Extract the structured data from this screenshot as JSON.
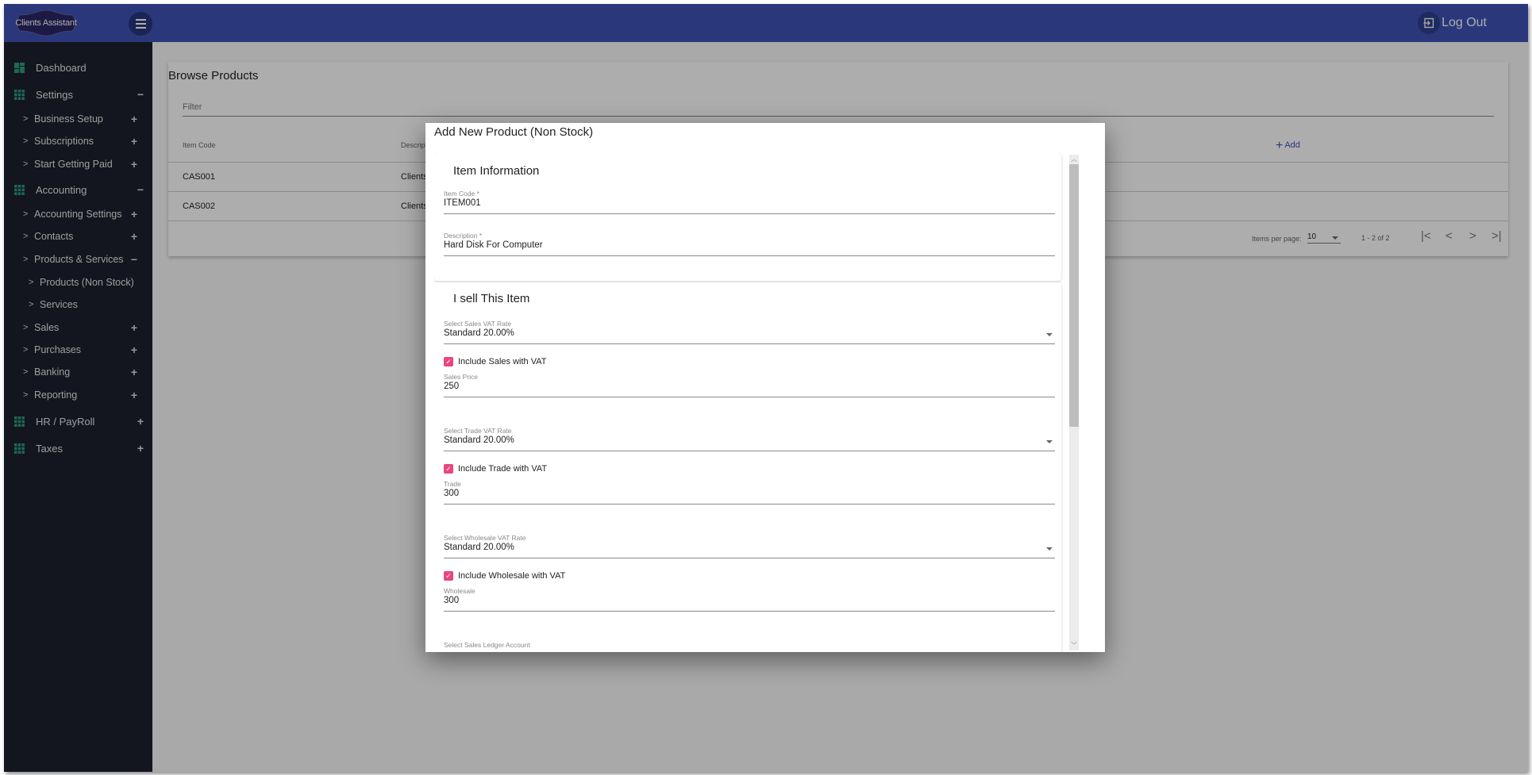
{
  "header": {
    "logo_text": "Clients Assistant",
    "logout_label": "Log Out"
  },
  "sidebar": {
    "items": [
      {
        "label": "Dashboard",
        "icon": "dashboard-icon",
        "level": 0,
        "toggle": ""
      },
      {
        "label": "Settings",
        "icon": "grid-icon",
        "level": 0,
        "toggle": "−"
      },
      {
        "label": "Business Setup",
        "level": 1,
        "toggle": "+"
      },
      {
        "label": "Subscriptions",
        "level": 1,
        "toggle": "+"
      },
      {
        "label": "Start Getting Paid",
        "level": 1,
        "toggle": "+"
      },
      {
        "label": "Accounting",
        "icon": "grid-icon",
        "level": 0,
        "toggle": "−"
      },
      {
        "label": "Accounting Settings",
        "level": 1,
        "toggle": "+"
      },
      {
        "label": "Contacts",
        "level": 1,
        "toggle": "+"
      },
      {
        "label": "Products & Services",
        "level": 1,
        "toggle": "−"
      },
      {
        "label": "Products (Non Stock)",
        "level": 2,
        "toggle": ""
      },
      {
        "label": "Services",
        "level": 2,
        "toggle": ""
      },
      {
        "label": "Sales",
        "level": 1,
        "toggle": "+"
      },
      {
        "label": "Purchases",
        "level": 1,
        "toggle": "+"
      },
      {
        "label": "Banking",
        "level": 1,
        "toggle": "+"
      },
      {
        "label": "Reporting",
        "level": 1,
        "toggle": "+"
      },
      {
        "label": "HR / PayRoll",
        "icon": "grid-icon",
        "level": 0,
        "toggle": "+"
      },
      {
        "label": "Taxes",
        "icon": "grid-icon",
        "level": 0,
        "toggle": "+"
      }
    ]
  },
  "browse": {
    "title": "Browse Products",
    "filter_placeholder": "Filter",
    "columns": [
      "Item Code",
      "Description"
    ],
    "add_label": "Add",
    "rows": [
      {
        "code": "CAS001",
        "description": "Clients"
      },
      {
        "code": "CAS002",
        "description": "Clients"
      }
    ],
    "paginator": {
      "items_per_page_label": "Items per page:",
      "items_per_page": "10",
      "range": "1 - 2 of 2"
    }
  },
  "dialog": {
    "title": "Add New Product (Non Stock)",
    "item_info": {
      "title": "Item Information",
      "item_code_label": "Item Code *",
      "item_code": "ITEM001",
      "description_label": "Description *",
      "description": "Hard Disk For Computer"
    },
    "sell": {
      "title": "I sell This Item",
      "sales_vat_label": "Select Sales VAT Rate",
      "sales_vat": "Standard 20.00%",
      "include_sales_vat": "Include Sales with VAT",
      "include_sales_vat_checked": true,
      "sales_price_label": "Sales Price",
      "sales_price": "250",
      "trade_vat_label": "Select Trade VAT Rate",
      "trade_vat": "Standard 20.00%",
      "include_trade_vat": "Include Trade with VAT",
      "include_trade_vat_checked": true,
      "trade_label": "Trade",
      "trade": "300",
      "wholesale_vat_label": "Select Wholesale VAT Rate",
      "wholesale_vat": "Standard 20.00%",
      "include_wholesale_vat": "Include Wholesale with VAT",
      "include_wholesale_vat_checked": true,
      "wholesale_label": "Wholesale",
      "wholesale": "300",
      "sales_ledger_label": "Select Sales Ledger Account"
    }
  },
  "colors": {
    "primary": "#3f51b5",
    "sidebar_bg": "#1c212d",
    "accent_checkbox": "#e94581",
    "icon_green": "#1f8a6e"
  }
}
